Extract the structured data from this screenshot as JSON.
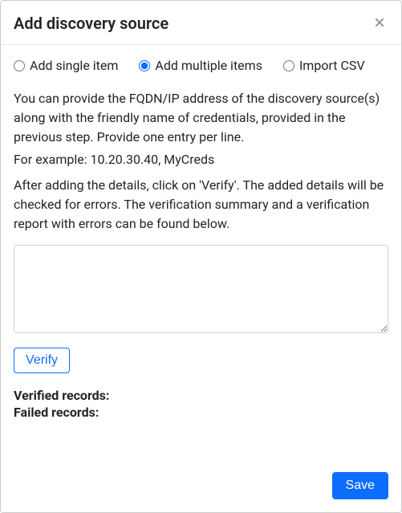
{
  "header": {
    "title": "Add discovery source",
    "close_icon": "×"
  },
  "radios": {
    "single": {
      "label": "Add single item",
      "checked": false
    },
    "multiple": {
      "label": "Add multiple items",
      "checked": true
    },
    "import_csv": {
      "label": "Import CSV",
      "checked": false
    }
  },
  "instructions": {
    "p1": "You can provide the FQDN/IP address of the discovery source(s) along with the friendly name of credentials, provided in the previous step. Provide one entry per line.",
    "p2": "For example: 10.20.30.40, MyCreds",
    "p3": "After adding the details, click on 'Verify'. The added details will be checked for errors. The verification summary and a verification report with errors can be found below."
  },
  "textarea": {
    "value": "",
    "placeholder": ""
  },
  "buttons": {
    "verify": "Verify",
    "save": "Save"
  },
  "summary": {
    "verified_label": "Verified records:",
    "verified_value": "",
    "failed_label": "Failed records:",
    "failed_value": ""
  }
}
